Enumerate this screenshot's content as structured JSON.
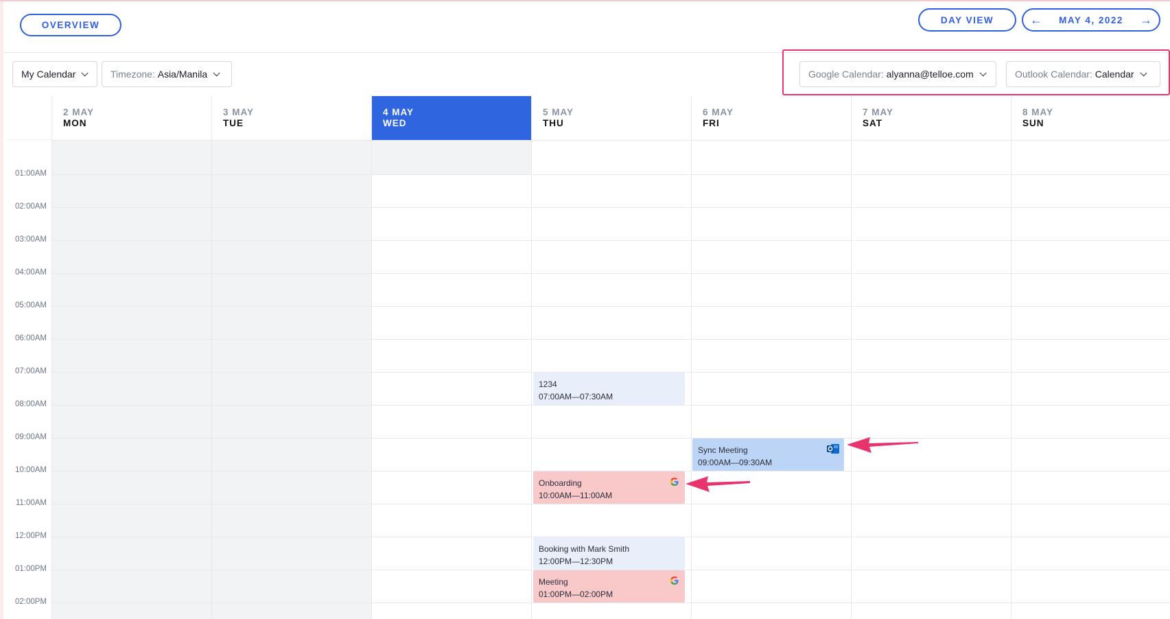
{
  "header": {
    "overview_label": "OVERVIEW",
    "dayview_label": "DAY VIEW",
    "prev_icon": "arrow-left-icon",
    "next_icon": "arrow-right-icon",
    "current_date": "MAY 4, 2022"
  },
  "filters": {
    "my_calendar": "My Calendar",
    "timezone_label": "Timezone:",
    "timezone_value": "Asia/Manila",
    "google_label": "Google Calendar:",
    "google_value": "alyanna@telloe.com",
    "outlook_label": "Outlook Calendar:",
    "outlook_value": "Calendar"
  },
  "days": [
    {
      "date": "2 MAY",
      "weekday": "MON"
    },
    {
      "date": "3 MAY",
      "weekday": "TUE"
    },
    {
      "date": "4 MAY",
      "weekday": "WED"
    },
    {
      "date": "5 MAY",
      "weekday": "THU"
    },
    {
      "date": "6 MAY",
      "weekday": "FRI"
    },
    {
      "date": "7 MAY",
      "weekday": "SAT"
    },
    {
      "date": "8 MAY",
      "weekday": "SUN"
    }
  ],
  "times": [
    "01:00AM",
    "02:00AM",
    "03:00AM",
    "04:00AM",
    "05:00AM",
    "06:00AM",
    "07:00AM",
    "08:00AM",
    "09:00AM",
    "10:00AM",
    "11:00AM",
    "12:00PM",
    "01:00PM",
    "02:00PM"
  ],
  "events": [
    {
      "title": "1234",
      "time": "07:00AM—07:30AM",
      "source": "none"
    },
    {
      "title": "Sync Meeting",
      "time": "09:00AM—09:30AM",
      "source": "outlook"
    },
    {
      "title": "Onboarding",
      "time": "10:00AM—11:00AM",
      "source": "google"
    },
    {
      "title": "Booking with Mark Smith",
      "time": "12:00PM—12:30PM",
      "source": "none"
    },
    {
      "title": "Meeting",
      "time": "01:00PM—02:00PM",
      "source": "google"
    }
  ],
  "colors": {
    "accent": "#2f66df",
    "annotation": "#e8336d",
    "google_event": "#f9c8c8",
    "outlook_event": "#bcd5f7",
    "booking_event": "#e9eefb"
  }
}
